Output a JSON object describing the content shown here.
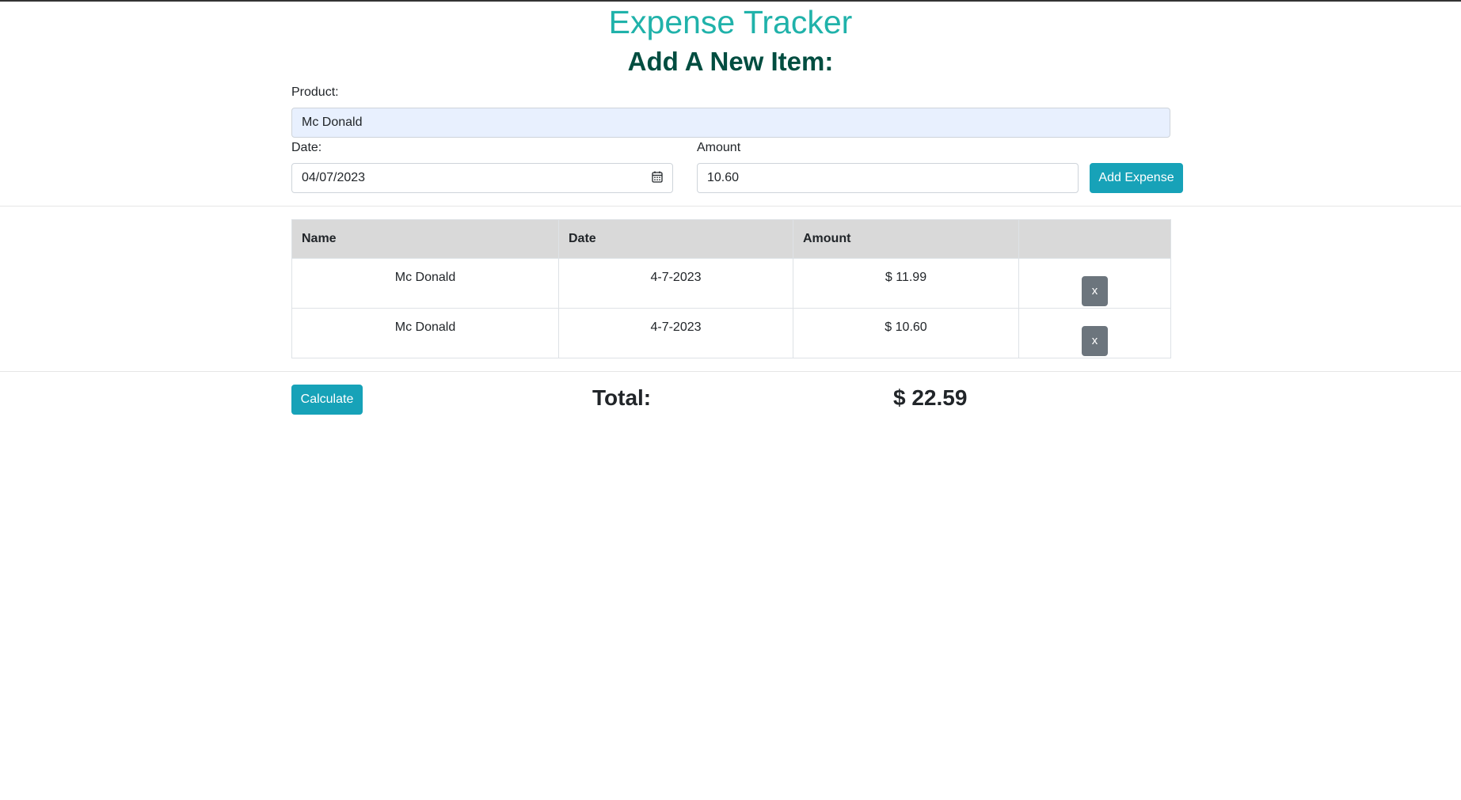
{
  "header": {
    "app_title": "Expense Tracker",
    "form_heading": "Add A New Item:"
  },
  "form": {
    "product_label": "Product:",
    "product_value": "Mc Donald",
    "date_label": "Date:",
    "date_value": "04/07/2023",
    "date_icon": "calendar-icon",
    "amount_label": "Amount",
    "amount_value": "10.60",
    "add_button_label": "Add Expense"
  },
  "table": {
    "columns": [
      "Name",
      "Date",
      "Amount",
      ""
    ],
    "rows": [
      {
        "name": "Mc Donald",
        "date": "4-7-2023",
        "amount": "$ 11.99",
        "delete_label": "x"
      },
      {
        "name": "Mc Donald",
        "date": "4-7-2023",
        "amount": "$ 10.60",
        "delete_label": "x"
      }
    ]
  },
  "footer": {
    "calculate_label": "Calculate",
    "total_label": "Total:",
    "total_value": "$ 22.59"
  },
  "colors": {
    "title": "#20b2aa",
    "heading": "#004d40",
    "button_info": "#17a2b8",
    "button_delete": "#6c757d",
    "table_header": "#d9d9d9",
    "autofill_bg": "#e8f0fe"
  }
}
